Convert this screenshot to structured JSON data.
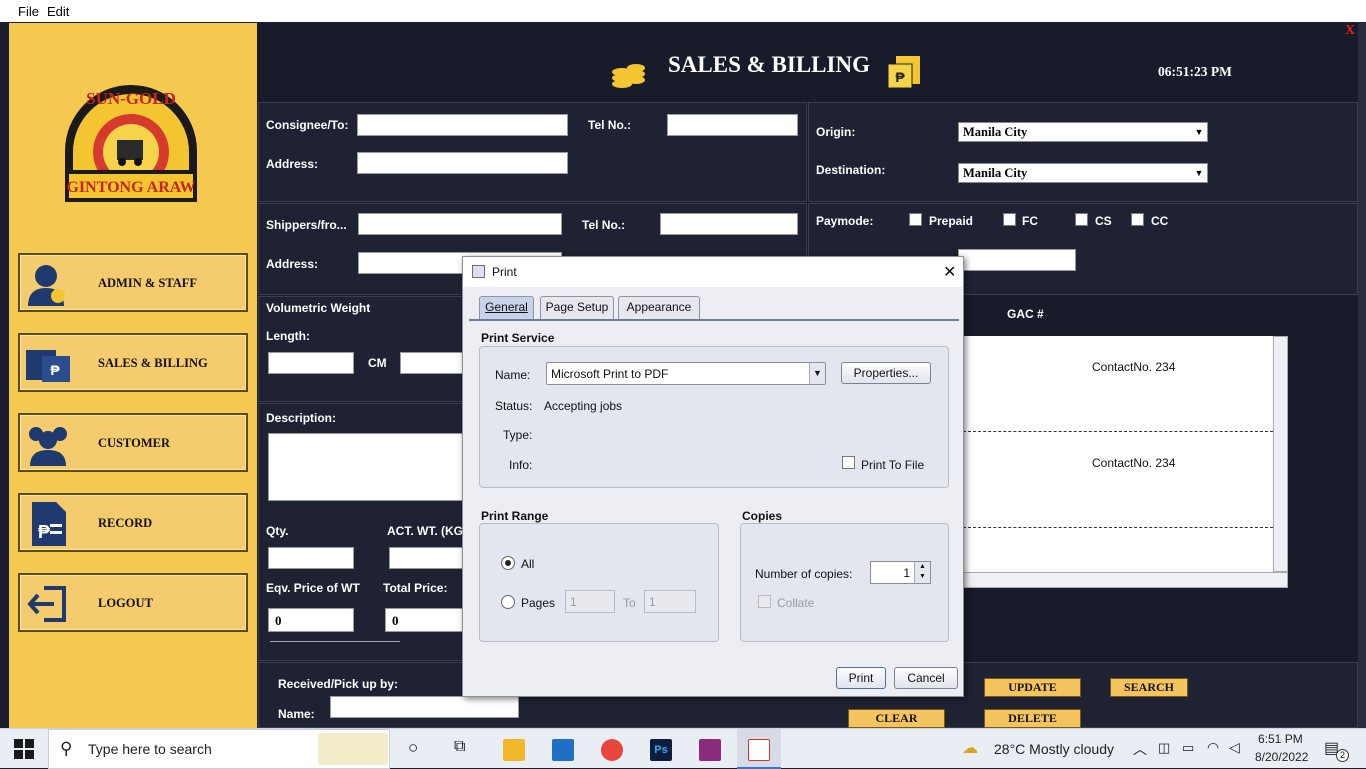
{
  "menubar": {
    "file": "File",
    "edit": "Edit"
  },
  "logo": {
    "top": "SUN-GOLD",
    "bottom": "GINTONG ARAW"
  },
  "sidebar": {
    "items": [
      {
        "label": "ADMIN & STAFF",
        "icon": "admin-icon"
      },
      {
        "label": "SALES & BILLING",
        "icon": "billing-icon"
      },
      {
        "label": "CUSTOMER",
        "icon": "users-icon"
      },
      {
        "label": "RECORD",
        "icon": "record-icon"
      },
      {
        "label": "LOGOUT",
        "icon": "logout-icon"
      }
    ]
  },
  "header": {
    "title": "SALES & BILLING",
    "time": "06:51:23 PM",
    "close": "X"
  },
  "form": {
    "consignee_label": "Consignee/To:",
    "tel_label": "Tel No.:",
    "address_label": "Address:",
    "shipper_label": "Shippers/fro...",
    "tel2_label": "Tel No.:",
    "address2_label": "Address:",
    "origin_label": "Origin:",
    "origin_value": "Manila City",
    "destination_label": "Destination:",
    "destination_value": "Manila City",
    "paymode_label": "Paymode:",
    "paymodes": [
      "Prepaid",
      "FC",
      "CS",
      "CC"
    ],
    "volumetric_label": "Volumetric Weight",
    "length_label": "Length:",
    "cm_label": "CM",
    "description_label": "Description:",
    "qty_label": "Qty.",
    "act_wt_label": "ACT. WT. (KG",
    "eqv_label": "Eqv. Price of WT",
    "total_label": "Total Price:",
    "eqv_value": "0",
    "total_value": "0",
    "gac_label": "GAC #",
    "contact_1": "ContactNo. 234",
    "contact_2": "ContactNo. 234",
    "received_label": "Received/Pick up by:",
    "name_label": "Name:"
  },
  "buttons": {
    "update": "UPDATE",
    "search": "SEARCH",
    "clear": "CLEAR",
    "delete": "DELETE"
  },
  "dialog": {
    "title": "Print",
    "tabs": [
      "General",
      "Page Setup",
      "Appearance"
    ],
    "print_service": "Print Service",
    "name_label": "Name:",
    "name_value": "Microsoft Print to PDF",
    "properties": "Properties...",
    "status_label": "Status:",
    "status_value": "Accepting jobs",
    "type_label": "Type:",
    "info_label": "Info:",
    "print_to_file": "Print To File",
    "print_range": "Print Range",
    "all": "All",
    "pages": "Pages",
    "pages_from": "1",
    "to": "To",
    "pages_to": "1",
    "copies": "Copies",
    "num_copies_label": "Number of copies:",
    "num_copies": "1",
    "collate": "Collate",
    "print_btn": "Print",
    "cancel_btn": "Cancel"
  },
  "taskbar": {
    "search_placeholder": "Type here to search",
    "weather": "28°C  Mostly cloudy",
    "time": "6:51 PM",
    "date": "8/20/2022",
    "notifications": "2"
  }
}
